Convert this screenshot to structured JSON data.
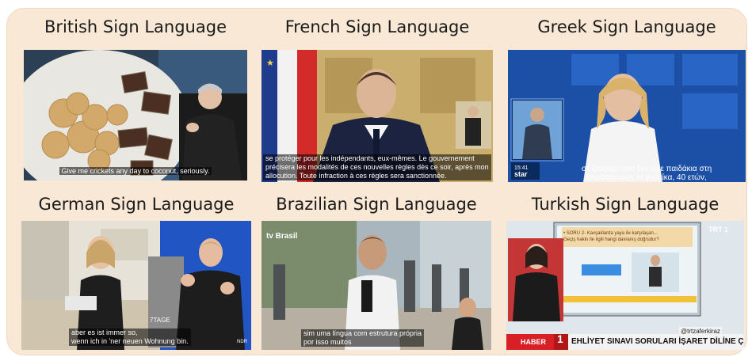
{
  "panels": [
    {
      "title": "British Sign Language",
      "subtitle_lines": [
        "Give me crickets any day to coconut, seriously."
      ]
    },
    {
      "title": "French Sign Language",
      "subtitle_lines": [
        "se protéger pour les indépendants, eux-mêmes. Le gouvernement",
        "précisera les modalités de ces nouvelles règles dès ce soir, après mon",
        "allocution. Toute infraction à ces règles sera sanctionnée."
      ]
    },
    {
      "title": "Greek Sign Language",
      "subtitle_lines": [
        "σε ζευγάρι που δεν είχε παιδάκια στη",
        "Θεσσαλονίκη. Η γυναίκα, 40 ετών,"
      ],
      "logo_time": "15:41",
      "logo_text": "star"
    },
    {
      "title": "German Sign Language",
      "subtitle_lines": [
        "aber es ist immer so,",
        "wenn ich in 'ner neuen Wohnung bin."
      ],
      "shirt_text": "7TAGE",
      "corner_text": "NDR"
    },
    {
      "title": "Brazilian Sign Language",
      "subtitle_lines": [
        "sim uma língua com estrutura própria",
        "por isso muitos"
      ],
      "logo_text": "tv Brasil"
    },
    {
      "title": "Turkish Sign Language",
      "ticker_label": "HABER",
      "ticker_number": "1",
      "ticker_text": "EHLİYET SINAVI SORULARI İŞARET DİLİNE ÇEVRİLDİ",
      "handle": "@trtzaferkiraz",
      "channel_logo": "TRT 1",
      "board_lines": [
        "• SORU 2- Kavşaklarda yaya ile karşılaşan...",
        "Geçiş hakkı ile ilgili hangi davranış doğrudur?"
      ]
    }
  ]
}
